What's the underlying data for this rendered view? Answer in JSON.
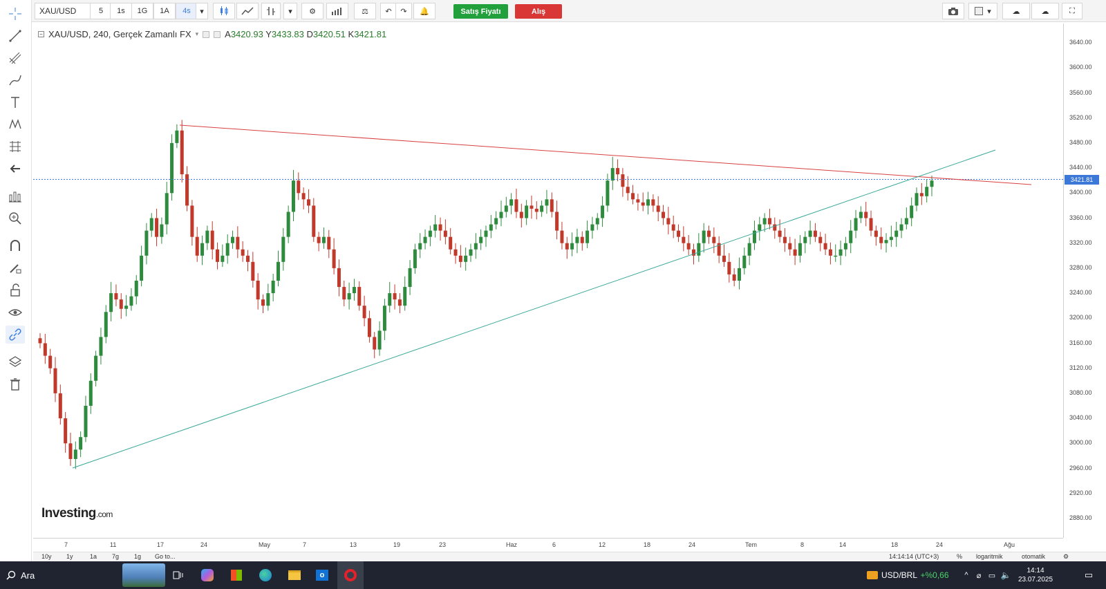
{
  "toolbar": {
    "symbol": "XAU/USD",
    "intervals": [
      "5",
      "1s",
      "1G",
      "1A",
      "4s"
    ],
    "active_interval": "4s",
    "sell_label": "Satış Fiyatı",
    "buy_label": "Alış"
  },
  "legend": {
    "title": "XAU/USD, 240, Gerçek Zamanlı FX",
    "open_label": "A",
    "open": "3420.93",
    "high_label": "Y",
    "high": "3433.83",
    "low_label": "D",
    "low": "3420.51",
    "close_label": "K",
    "close": "3421.81"
  },
  "brand": {
    "name": "Investing",
    "suffix": ".com"
  },
  "price_axis": {
    "labels": [
      "3640.00",
      "3600.00",
      "3560.00",
      "3520.00",
      "3480.00",
      "3440.00",
      "3400.00",
      "3360.00",
      "3320.00",
      "3280.00",
      "3240.00",
      "3200.00",
      "3160.00",
      "3120.00",
      "3080.00",
      "3040.00",
      "3000.00",
      "2960.00",
      "2920.00",
      "2880.00"
    ],
    "current_price": "3421.81"
  },
  "time_axis": {
    "labels": [
      "7",
      "11",
      "17",
      "24",
      "May",
      "7",
      "13",
      "19",
      "23",
      "Haz",
      "6",
      "12",
      "18",
      "24",
      "Tem",
      "8",
      "14",
      "18",
      "24",
      "Ağu"
    ]
  },
  "range_bar": {
    "ranges": [
      "10y",
      "1y",
      "1a",
      "7g",
      "1g"
    ],
    "goto": "Go to...",
    "time": "14:14:14 (UTC+3)",
    "percent": "%",
    "log": "logaritmik",
    "auto": "otomatik"
  },
  "taskbar": {
    "search": "Ara",
    "ticker_name": "USD/BRL",
    "ticker_change": "+%0,66",
    "clock_time": "14:14",
    "clock_date": "23.07.2025"
  },
  "chart_data": {
    "type": "candlestick",
    "symbol": "XAU/USD",
    "interval": "240",
    "ylim": [
      2860,
      3660
    ],
    "price_ticks": [
      3640,
      3600,
      3560,
      3520,
      3480,
      3440,
      3400,
      3360,
      3320,
      3280,
      3240,
      3200,
      3160,
      3120,
      3080,
      3040,
      3000,
      2960,
      2920,
      2880
    ],
    "current_price": 3421.81,
    "x_tick_labels": [
      "7",
      "11",
      "17",
      "24",
      "May",
      "7",
      "13",
      "19",
      "23",
      "Haz",
      "6",
      "12",
      "18",
      "24",
      "Tem",
      "8",
      "14",
      "18",
      "24",
      "Ağu"
    ],
    "closes": [
      3160,
      3140,
      3120,
      3080,
      3040,
      3000,
      2975,
      2990,
      3010,
      3060,
      3100,
      3140,
      3170,
      3210,
      3240,
      3230,
      3215,
      3220,
      3235,
      3260,
      3300,
      3340,
      3360,
      3330,
      3350,
      3400,
      3480,
      3500,
      3430,
      3380,
      3330,
      3300,
      3320,
      3340,
      3310,
      3290,
      3300,
      3320,
      3330,
      3310,
      3300,
      3290,
      3260,
      3230,
      3220,
      3240,
      3260,
      3290,
      3330,
      3370,
      3420,
      3400,
      3390,
      3380,
      3330,
      3320,
      3330,
      3310,
      3280,
      3250,
      3230,
      3240,
      3250,
      3220,
      3200,
      3170,
      3150,
      3180,
      3220,
      3240,
      3230,
      3220,
      3250,
      3280,
      3310,
      3320,
      3330,
      3340,
      3350,
      3340,
      3330,
      3310,
      3300,
      3290,
      3300,
      3310,
      3320,
      3330,
      3340,
      3350,
      3360,
      3370,
      3380,
      3390,
      3370,
      3360,
      3380,
      3375,
      3370,
      3380,
      3390,
      3370,
      3340,
      3320,
      3310,
      3320,
      3330,
      3320,
      3340,
      3350,
      3360,
      3380,
      3420,
      3440,
      3430,
      3410,
      3400,
      3390,
      3385,
      3380,
      3390,
      3380,
      3370,
      3360,
      3350,
      3340,
      3330,
      3320,
      3310,
      3300,
      3320,
      3340,
      3330,
      3320,
      3300,
      3290,
      3270,
      3260,
      3280,
      3300,
      3320,
      3340,
      3350,
      3360,
      3350,
      3340,
      3330,
      3320,
      3310,
      3300,
      3320,
      3330,
      3340,
      3330,
      3320,
      3310,
      3300,
      3300,
      3310,
      3320,
      3340,
      3360,
      3370,
      3360,
      3340,
      3330,
      3320,
      3325,
      3330,
      3340,
      3350,
      3360,
      3380,
      3400,
      3395,
      3410,
      3420
    ]
  }
}
